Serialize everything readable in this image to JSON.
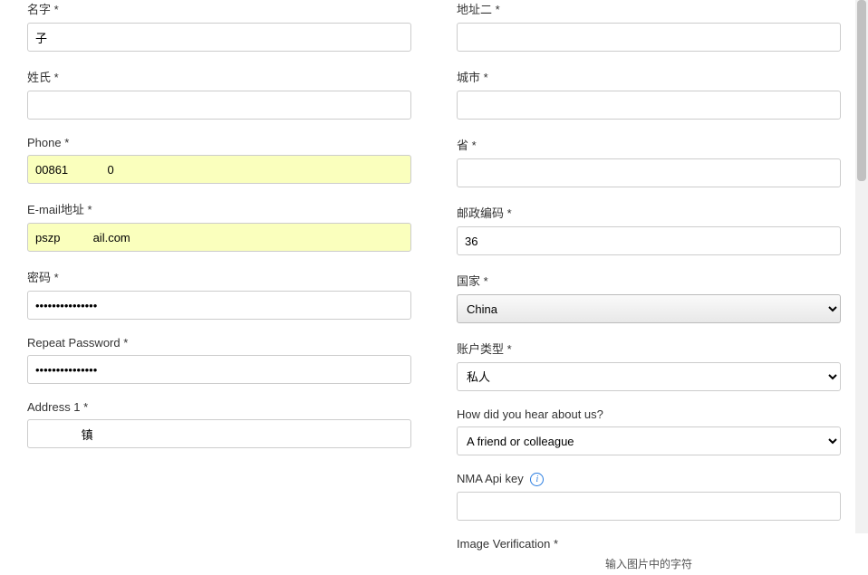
{
  "left": {
    "first_name": {
      "label": "名字 *",
      "value": "子"
    },
    "last_name": {
      "label": "姓氏 *",
      "value": ""
    },
    "phone": {
      "label": "Phone *",
      "value": "00861            0"
    },
    "email": {
      "label": "E-mail地址 *",
      "value": "pszp          ail.com"
    },
    "password": {
      "label": "密码 *",
      "value": "•••••••••••••••"
    },
    "repeat_pw": {
      "label": "Repeat Password *",
      "value": "•••••••••••••••"
    },
    "address1": {
      "label": "Address 1 *",
      "value": "              镇"
    }
  },
  "right": {
    "address2": {
      "label": "地址二 *",
      "value": ""
    },
    "city": {
      "label": "城市 *",
      "value": ""
    },
    "province": {
      "label": "省 *",
      "value": ""
    },
    "postcode": {
      "label": "邮政编码 *",
      "value": "36"
    },
    "country": {
      "label": "国家 *",
      "selected": "China"
    },
    "acct_type": {
      "label": "账户类型 *",
      "selected": "私人"
    },
    "hear_about": {
      "label": "How did you hear about us?",
      "selected": "A friend or colleague"
    },
    "api_key": {
      "label": "NMA Api key",
      "value": ""
    },
    "image_verif": {
      "label": "Image Verification *",
      "hint": "输入图片中的字符"
    }
  },
  "icons": {
    "info": "i"
  }
}
